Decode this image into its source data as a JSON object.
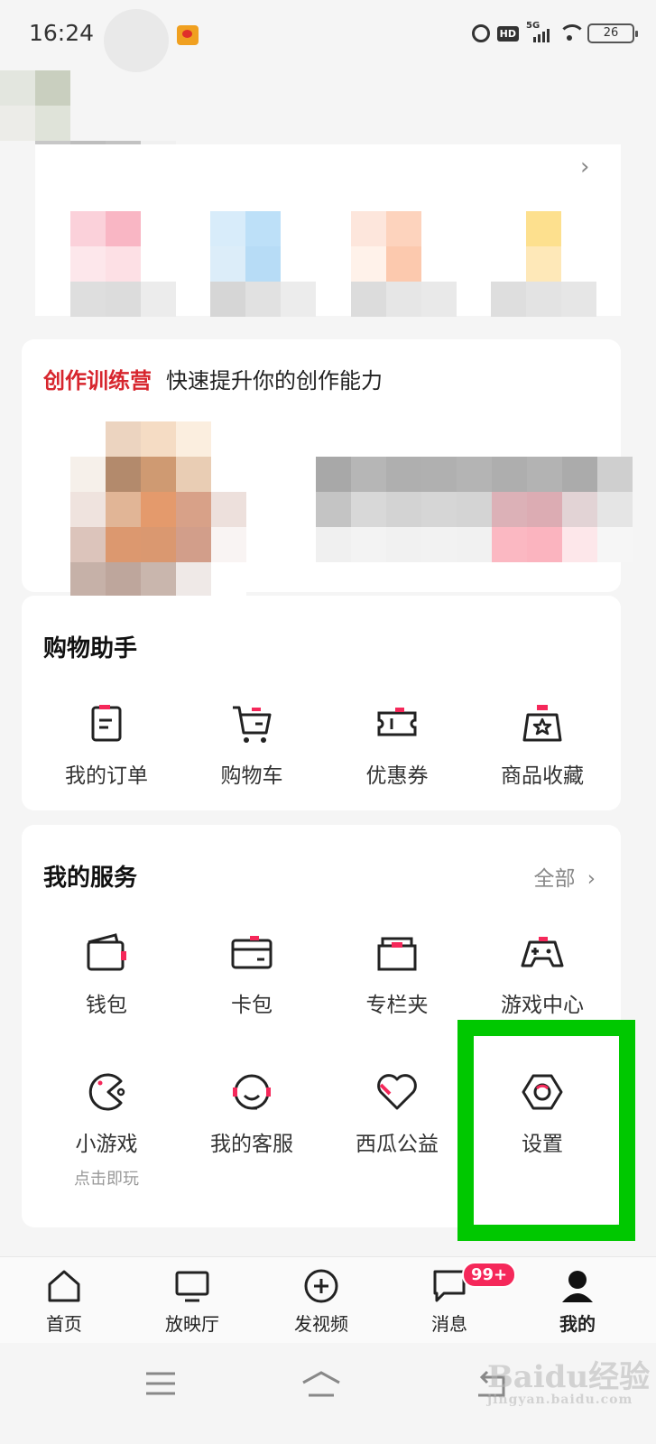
{
  "status_bar": {
    "time": "16:24",
    "network": "5G",
    "hd_label": "HD",
    "battery": "26"
  },
  "campaign": {
    "tag": "创作训练营",
    "description": "快速提升你的创作能力"
  },
  "shopping": {
    "title": "购物助手",
    "items": [
      {
        "label": "我的订单",
        "icon": "order-icon"
      },
      {
        "label": "购物车",
        "icon": "cart-icon"
      },
      {
        "label": "优惠券",
        "icon": "coupon-icon"
      },
      {
        "label": "商品收藏",
        "icon": "favorite-bag-icon"
      }
    ]
  },
  "services": {
    "title": "我的服务",
    "more_label": "全部",
    "items": [
      {
        "label": "钱包",
        "icon": "wallet-icon"
      },
      {
        "label": "卡包",
        "icon": "card-icon"
      },
      {
        "label": "专栏夹",
        "icon": "folder-icon"
      },
      {
        "label": "游戏中心",
        "icon": "gamepad-icon"
      },
      {
        "label": "小游戏",
        "sub": "点击即玩",
        "icon": "pacman-icon"
      },
      {
        "label": "我的客服",
        "icon": "headset-icon"
      },
      {
        "label": "西瓜公益",
        "icon": "heart-icon"
      },
      {
        "label": "设置",
        "icon": "settings-icon"
      }
    ]
  },
  "bottom_nav": {
    "items": [
      {
        "label": "首页",
        "icon": "home-icon"
      },
      {
        "label": "放映厅",
        "icon": "tv-icon"
      },
      {
        "label": "发视频",
        "icon": "add-video-icon"
      },
      {
        "label": "消息",
        "icon": "message-icon"
      },
      {
        "label": "我的",
        "icon": "profile-icon"
      }
    ],
    "message_badge": "99+"
  },
  "watermark": {
    "text": "Baidu经验",
    "sub": "jingyan.baidu.com"
  },
  "colors": {
    "accent_red": "#d7262e",
    "highlight_green": "#00c800",
    "badge_pink": "#f5285a"
  }
}
